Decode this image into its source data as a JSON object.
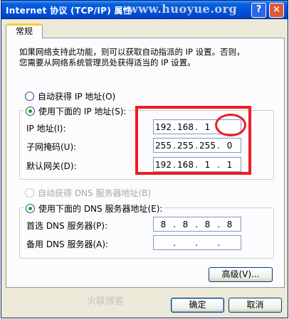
{
  "window": {
    "title": "Internet 协议 (TCP/IP) 属性",
    "help_label": "?",
    "close_label": "×",
    "watermark": "www.huoyue.org"
  },
  "tabs": [
    {
      "label": "常规"
    }
  ],
  "description": [
    "如果网络支持此功能，则可以获取自动指派的 IP 设置。否则，",
    "您需要从网络系统管理员处获得适当的 IP 设置。"
  ],
  "ip_mode": {
    "auto_label": "自动获得 IP 地址(O)",
    "manual_label": "使用下面的 IP 地址(S):",
    "selected": "manual"
  },
  "ip_fields": [
    {
      "label": "IP 地址(I):",
      "octets": [
        "192",
        "168",
        "1",
        ""
      ]
    },
    {
      "label": "子网掩码(U):",
      "octets": [
        "255",
        "255",
        "255",
        "0"
      ]
    },
    {
      "label": "默认网关(D):",
      "octets": [
        "192",
        "168",
        "1",
        "1"
      ]
    }
  ],
  "dns_mode": {
    "auto_label": "自动获得 DNS 服务器地址(B)",
    "manual_label": "使用下面的 DNS 服务器地址(E):",
    "selected": "manual"
  },
  "dns_fields": [
    {
      "label": "首选 DNS 服务器(P):",
      "octets": [
        "8",
        "8",
        "8",
        "8"
      ]
    },
    {
      "label": "备用 DNS 服务器(A):",
      "octets": [
        "",
        "",
        "",
        ""
      ]
    }
  ],
  "buttons": {
    "advanced": "高级(V)...",
    "ok": "确定",
    "cancel": "取消"
  },
  "bottom_watermark": "火联博客",
  "colors": {
    "highlight": "#ee1c24",
    "titlebar": "#0054e3",
    "dialog_bg": "#ece9d8"
  }
}
